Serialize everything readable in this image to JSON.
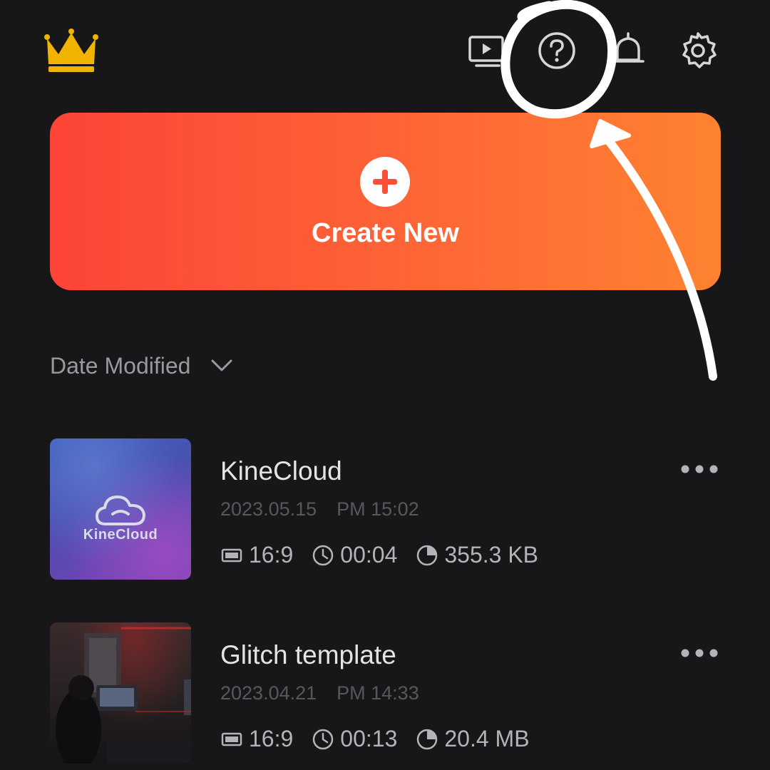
{
  "header": {
    "icons": [
      "crown-icon",
      "player-icon",
      "help-icon",
      "bell-icon",
      "gear-icon"
    ],
    "brand_color": "#f0b400"
  },
  "create_new": {
    "label": "Create New",
    "gradient_start": "#fc4437",
    "gradient_end": "#fe8231"
  },
  "sort": {
    "label": "Date Modified"
  },
  "projects": [
    {
      "title": "KineCloud",
      "thumbnail_text": "KineCloud",
      "date": "2023.05.15",
      "time": "PM 15:02",
      "ratio": "16:9",
      "duration": "00:04",
      "size": "355.3 KB"
    },
    {
      "title": "Glitch template",
      "date": "2023.04.21",
      "time": "PM 14:33",
      "ratio": "16:9",
      "duration": "00:13",
      "size": "20.4 MB"
    }
  ],
  "annotation": {
    "type": "hand-drawn circle with arrow",
    "target": "help-icon",
    "color": "#ffffff"
  }
}
